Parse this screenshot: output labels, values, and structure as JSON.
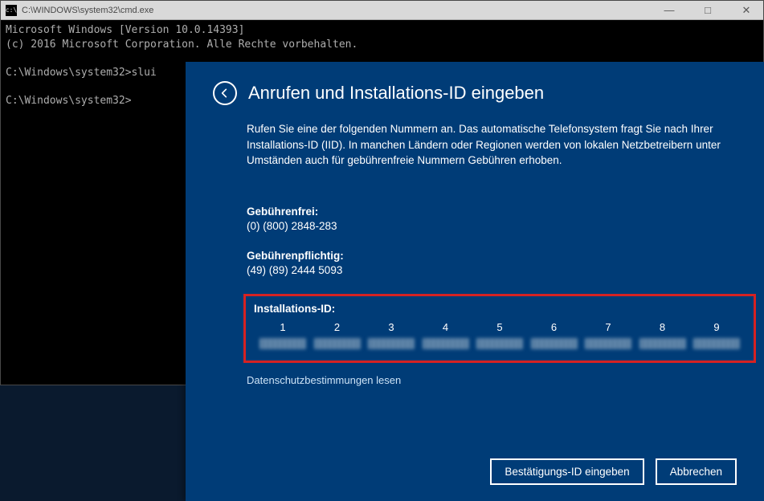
{
  "cmd": {
    "title": "C:\\WINDOWS\\system32\\cmd.exe",
    "line1": "Microsoft Windows [Version 10.0.14393]",
    "line2": "(c) 2016 Microsoft Corporation. Alle Rechte vorbehalten.",
    "prompt1": "C:\\Windows\\system32>slui",
    "prompt2": "C:\\Windows\\system32>"
  },
  "dialog": {
    "title": "Anrufen und Installations-ID eingeben",
    "description": "Rufen Sie eine der folgenden Nummern an. Das automatische Telefonsystem fragt Sie nach Ihrer Installations-ID (IID). In manchen Ländern oder Regionen werden von lokalen Netzbetreibern unter Umständen auch für gebührenfreie Nummern Gebühren erhoben.",
    "tollfree_label": "Gebührenfrei:",
    "tollfree_number": "(0) (800) 2848-283",
    "toll_label": "Gebührenpflichtig:",
    "toll_number": "(49) (89) 2444 5093",
    "iid_label": "Installations-ID:",
    "iid_columns": [
      "1",
      "2",
      "3",
      "4",
      "5",
      "6",
      "7",
      "8",
      "9"
    ],
    "privacy": "Datenschutzbestimmungen lesen",
    "confirm_btn": "Bestätigungs-ID eingeben",
    "cancel_btn": "Abbrechen"
  },
  "window_controls": {
    "minimize": "—",
    "maximize": "□",
    "close": "✕"
  }
}
